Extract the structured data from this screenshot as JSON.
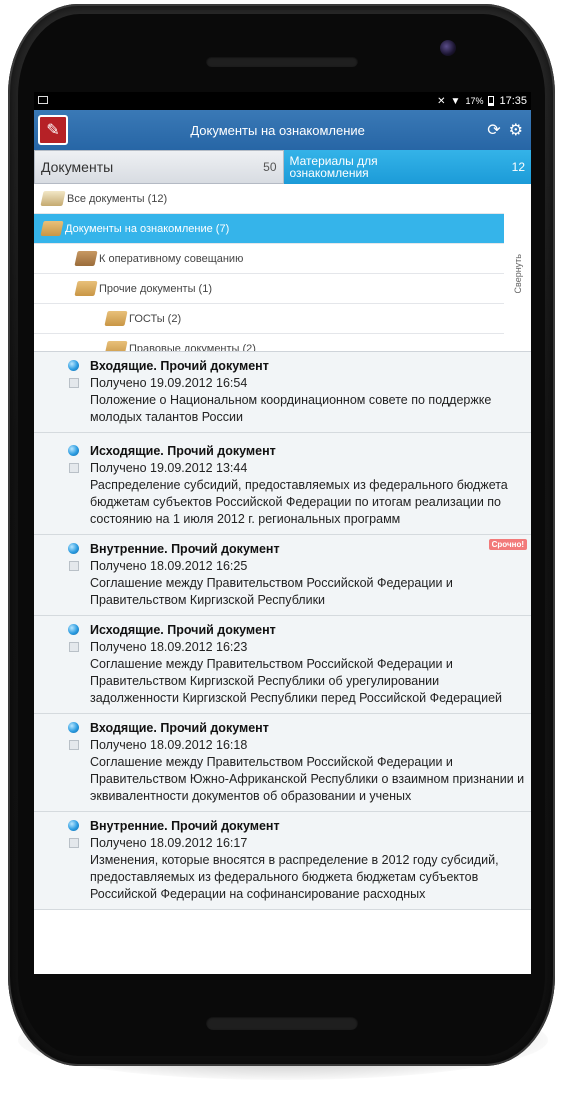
{
  "statusbar": {
    "battery": "17%",
    "time": "17:35",
    "icons": [
      "image-icon",
      "mute-icon",
      "wifi-icon",
      "battery-icon"
    ]
  },
  "appbar": {
    "title": "Документы на ознакомление",
    "icons": [
      "refresh-icon",
      "gear-icon"
    ]
  },
  "tabs": [
    {
      "label": "Документы",
      "count": "50"
    },
    {
      "label_line1": "Материалы для",
      "label_line2": "ознакомления",
      "count": "12"
    }
  ],
  "folders": {
    "collapse_label": "Свернуть",
    "items": [
      {
        "label": "Все документы (12)"
      },
      {
        "label": "Документы на ознакомление (7)"
      },
      {
        "label": "К оперативному совещанию"
      },
      {
        "label": "Прочие документы (1)"
      },
      {
        "label": "ГОСТы (2)"
      },
      {
        "label": "Правовые документы (2)"
      }
    ]
  },
  "documents": [
    {
      "type": "Входящие. Прочий документ",
      "received": "Получено 19.09.2012 16:54",
      "text": "Положение о Национальном координационном совете по поддержке молодых талантов России"
    },
    {
      "type": "Исходящие. Прочий документ",
      "received": "Получено 19.09.2012 13:44",
      "text": "Распределение субсидий, предоставляемых из федерального бюджета бюджетам субъектов Российской Федерации по итогам реализации по состоянию на 1 июля 2012 г. региональных программ"
    },
    {
      "type": "Внутренние. Прочий документ",
      "received": "Получено 18.09.2012 16:25",
      "text": "Соглашение между Правительством Российской Федерации и Правительством Киргизской Республики",
      "badge": "Срочно!"
    },
    {
      "type": "Исходящие. Прочий документ",
      "received": "Получено 18.09.2012 16:23",
      "text": "Соглашение между Правительством Российской Федерации и Правительством Киргизской Республики об урегулировании задолженности Киргизской Республики перед Российской Федерацией"
    },
    {
      "type": "Входящие. Прочий документ",
      "received": "Получено 18.09.2012 16:18",
      "text": "Соглашение между Правительством Российской Федерации и Правительством Южно-Африканской Республики о взаимном признании и эквивалентности документов об образовании и ученых"
    },
    {
      "type": "Внутренние. Прочий документ",
      "received": "Получено 18.09.2012 16:17",
      "text": "Изменения, которые вносятся в распределение в 2012 году субсидий, предоставляемых из федерального бюджета бюджетам субъектов Российской Федерации на софинансирование расходных"
    }
  ]
}
